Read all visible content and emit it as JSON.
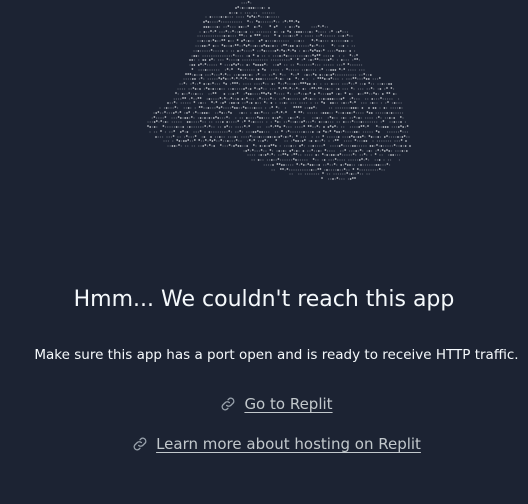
{
  "error": {
    "title": "Hmm... We couldn't reach this app",
    "message": "Make sure this app has a port open and is ready to receive HTTP traffic."
  },
  "links": [
    {
      "label": "Go to Replit",
      "icon": "link-icon"
    },
    {
      "label": "Learn more about hosting on Replit",
      "icon": "link-icon"
    }
  ],
  "illustration": {
    "name": "ascii-dotted-cloud"
  },
  "colors": {
    "background": "#1c2333",
    "text": "#f5f9fc",
    "link": "#c2c8cc",
    "art": "#c9cdd3"
  }
}
